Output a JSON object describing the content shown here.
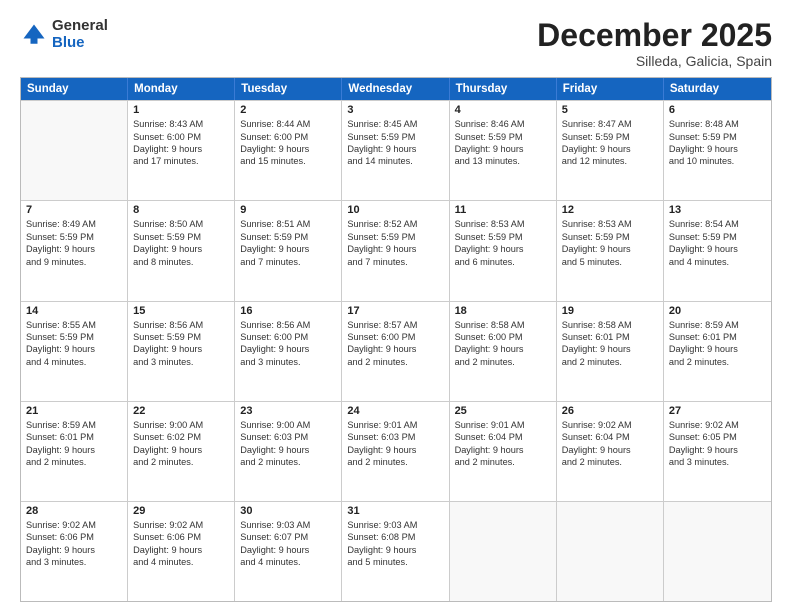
{
  "header": {
    "logo_general": "General",
    "logo_blue": "Blue",
    "month": "December 2025",
    "location": "Silleda, Galicia, Spain"
  },
  "days_of_week": [
    "Sunday",
    "Monday",
    "Tuesday",
    "Wednesday",
    "Thursday",
    "Friday",
    "Saturday"
  ],
  "weeks": [
    [
      {
        "day": "",
        "text": ""
      },
      {
        "day": "1",
        "text": "Sunrise: 8:43 AM\nSunset: 6:00 PM\nDaylight: 9 hours\nand 17 minutes."
      },
      {
        "day": "2",
        "text": "Sunrise: 8:44 AM\nSunset: 6:00 PM\nDaylight: 9 hours\nand 15 minutes."
      },
      {
        "day": "3",
        "text": "Sunrise: 8:45 AM\nSunset: 5:59 PM\nDaylight: 9 hours\nand 14 minutes."
      },
      {
        "day": "4",
        "text": "Sunrise: 8:46 AM\nSunset: 5:59 PM\nDaylight: 9 hours\nand 13 minutes."
      },
      {
        "day": "5",
        "text": "Sunrise: 8:47 AM\nSunset: 5:59 PM\nDaylight: 9 hours\nand 12 minutes."
      },
      {
        "day": "6",
        "text": "Sunrise: 8:48 AM\nSunset: 5:59 PM\nDaylight: 9 hours\nand 10 minutes."
      }
    ],
    [
      {
        "day": "7",
        "text": "Sunrise: 8:49 AM\nSunset: 5:59 PM\nDaylight: 9 hours\nand 9 minutes."
      },
      {
        "day": "8",
        "text": "Sunrise: 8:50 AM\nSunset: 5:59 PM\nDaylight: 9 hours\nand 8 minutes."
      },
      {
        "day": "9",
        "text": "Sunrise: 8:51 AM\nSunset: 5:59 PM\nDaylight: 9 hours\nand 7 minutes."
      },
      {
        "day": "10",
        "text": "Sunrise: 8:52 AM\nSunset: 5:59 PM\nDaylight: 9 hours\nand 7 minutes."
      },
      {
        "day": "11",
        "text": "Sunrise: 8:53 AM\nSunset: 5:59 PM\nDaylight: 9 hours\nand 6 minutes."
      },
      {
        "day": "12",
        "text": "Sunrise: 8:53 AM\nSunset: 5:59 PM\nDaylight: 9 hours\nand 5 minutes."
      },
      {
        "day": "13",
        "text": "Sunrise: 8:54 AM\nSunset: 5:59 PM\nDaylight: 9 hours\nand 4 minutes."
      }
    ],
    [
      {
        "day": "14",
        "text": "Sunrise: 8:55 AM\nSunset: 5:59 PM\nDaylight: 9 hours\nand 4 minutes."
      },
      {
        "day": "15",
        "text": "Sunrise: 8:56 AM\nSunset: 5:59 PM\nDaylight: 9 hours\nand 3 minutes."
      },
      {
        "day": "16",
        "text": "Sunrise: 8:56 AM\nSunset: 6:00 PM\nDaylight: 9 hours\nand 3 minutes."
      },
      {
        "day": "17",
        "text": "Sunrise: 8:57 AM\nSunset: 6:00 PM\nDaylight: 9 hours\nand 2 minutes."
      },
      {
        "day": "18",
        "text": "Sunrise: 8:58 AM\nSunset: 6:00 PM\nDaylight: 9 hours\nand 2 minutes."
      },
      {
        "day": "19",
        "text": "Sunrise: 8:58 AM\nSunset: 6:01 PM\nDaylight: 9 hours\nand 2 minutes."
      },
      {
        "day": "20",
        "text": "Sunrise: 8:59 AM\nSunset: 6:01 PM\nDaylight: 9 hours\nand 2 minutes."
      }
    ],
    [
      {
        "day": "21",
        "text": "Sunrise: 8:59 AM\nSunset: 6:01 PM\nDaylight: 9 hours\nand 2 minutes."
      },
      {
        "day": "22",
        "text": "Sunrise: 9:00 AM\nSunset: 6:02 PM\nDaylight: 9 hours\nand 2 minutes."
      },
      {
        "day": "23",
        "text": "Sunrise: 9:00 AM\nSunset: 6:03 PM\nDaylight: 9 hours\nand 2 minutes."
      },
      {
        "day": "24",
        "text": "Sunrise: 9:01 AM\nSunset: 6:03 PM\nDaylight: 9 hours\nand 2 minutes."
      },
      {
        "day": "25",
        "text": "Sunrise: 9:01 AM\nSunset: 6:04 PM\nDaylight: 9 hours\nand 2 minutes."
      },
      {
        "day": "26",
        "text": "Sunrise: 9:02 AM\nSunset: 6:04 PM\nDaylight: 9 hours\nand 2 minutes."
      },
      {
        "day": "27",
        "text": "Sunrise: 9:02 AM\nSunset: 6:05 PM\nDaylight: 9 hours\nand 3 minutes."
      }
    ],
    [
      {
        "day": "28",
        "text": "Sunrise: 9:02 AM\nSunset: 6:06 PM\nDaylight: 9 hours\nand 3 minutes."
      },
      {
        "day": "29",
        "text": "Sunrise: 9:02 AM\nSunset: 6:06 PM\nDaylight: 9 hours\nand 4 minutes."
      },
      {
        "day": "30",
        "text": "Sunrise: 9:03 AM\nSunset: 6:07 PM\nDaylight: 9 hours\nand 4 minutes."
      },
      {
        "day": "31",
        "text": "Sunrise: 9:03 AM\nSunset: 6:08 PM\nDaylight: 9 hours\nand 5 minutes."
      },
      {
        "day": "",
        "text": ""
      },
      {
        "day": "",
        "text": ""
      },
      {
        "day": "",
        "text": ""
      }
    ]
  ]
}
